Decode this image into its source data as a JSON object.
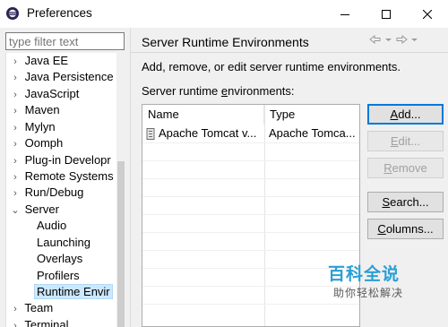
{
  "window": {
    "title": "Preferences"
  },
  "filter": {
    "placeholder": "type filter text"
  },
  "tree": {
    "items": [
      {
        "label": "Java EE",
        "toggle": "›"
      },
      {
        "label": "Java Persistence",
        "toggle": "›"
      },
      {
        "label": "JavaScript",
        "toggle": "›"
      },
      {
        "label": "Maven",
        "toggle": "›"
      },
      {
        "label": "Mylyn",
        "toggle": "›"
      },
      {
        "label": "Oomph",
        "toggle": "›"
      },
      {
        "label": "Plug-in Developr",
        "toggle": "›"
      },
      {
        "label": "Remote Systems",
        "toggle": "›"
      },
      {
        "label": "Run/Debug",
        "toggle": "›"
      },
      {
        "label": "Server",
        "toggle": "⌄"
      },
      {
        "label": "Audio"
      },
      {
        "label": "Launching"
      },
      {
        "label": "Overlays"
      },
      {
        "label": "Profilers"
      },
      {
        "label": "Runtime Envir",
        "selected": true
      },
      {
        "label": "Team",
        "toggle": "›"
      },
      {
        "label": "Terminal",
        "toggle": "›"
      }
    ]
  },
  "page": {
    "title": "Server Runtime Environments",
    "description": "Add, remove, or edit server runtime environments.",
    "list_label_pre": "Server runtime ",
    "list_label_mnemonic": "e",
    "list_label_post": "nvironments:"
  },
  "table": {
    "columns": [
      "Name",
      "Type"
    ],
    "rows": [
      {
        "name": "Apache Tomcat v...",
        "type": "Apache Tomca..."
      }
    ]
  },
  "buttons": {
    "add": {
      "mnemonic": "A",
      "rest": "dd..."
    },
    "edit": {
      "mnemonic": "E",
      "rest": "dit..."
    },
    "remove": {
      "mnemonic": "R",
      "rest": "emove"
    },
    "search": {
      "mnemonic": "S",
      "rest": "earch..."
    },
    "columns": {
      "mnemonic": "C",
      "rest": "olumns..."
    }
  },
  "watermark": {
    "title": "百科全说",
    "subtitle": "助你轻松解决"
  },
  "colors": {
    "accent": "#0078d7",
    "selection": "#cce8ff",
    "watermark": "#2a9fd6"
  }
}
